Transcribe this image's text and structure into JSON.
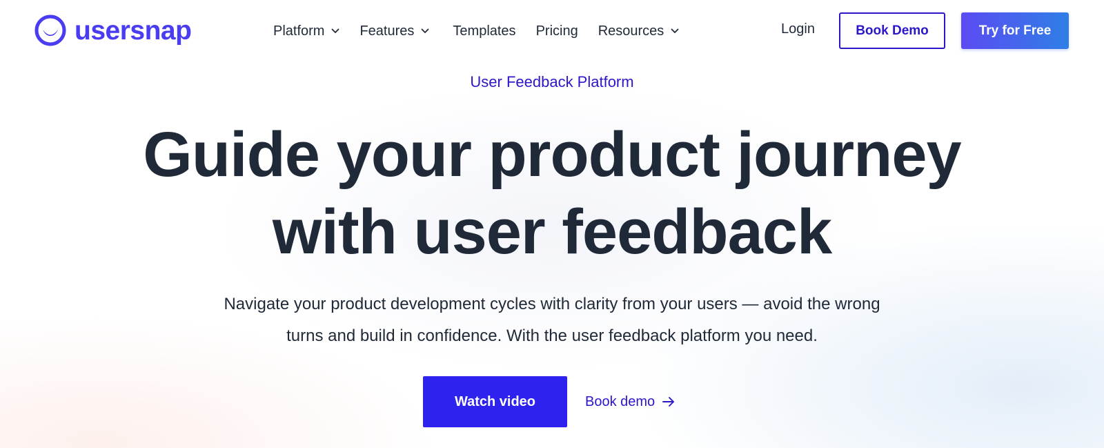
{
  "brand": {
    "name": "usersnap",
    "color": "#4a3cf0",
    "logo_icon": "usersnap-smile-icon"
  },
  "nav": {
    "items": [
      {
        "label": "Platform",
        "has_dropdown": true
      },
      {
        "label": "Features",
        "has_dropdown": true
      },
      {
        "label": "Templates",
        "has_dropdown": false
      },
      {
        "label": "Pricing",
        "has_dropdown": false
      },
      {
        "label": "Resources",
        "has_dropdown": true
      }
    ],
    "login_label": "Login",
    "book_demo_label": "Book Demo",
    "try_free_label": "Try for Free"
  },
  "hero": {
    "eyebrow": "User Feedback Platform",
    "headline_line1": "Guide your product journey",
    "headline_line2": "with user feedback",
    "subtext_line1": "Navigate your product development cycles with clarity from your users — avoid the wrong",
    "subtext_line2": "turns and build in confidence. With the user feedback platform you need.",
    "watch_video_label": "Watch video",
    "book_demo_link_label": "Book demo"
  },
  "colors": {
    "accent": "#2e22ee",
    "accent_dark": "#2b17c9",
    "text": "#1f2937",
    "gradient_start": "#5b4bf3",
    "gradient_end": "#2f7fe6"
  },
  "icons": {
    "dropdown": "chevron-down-icon",
    "link_arrow": "arrow-right-icon"
  }
}
